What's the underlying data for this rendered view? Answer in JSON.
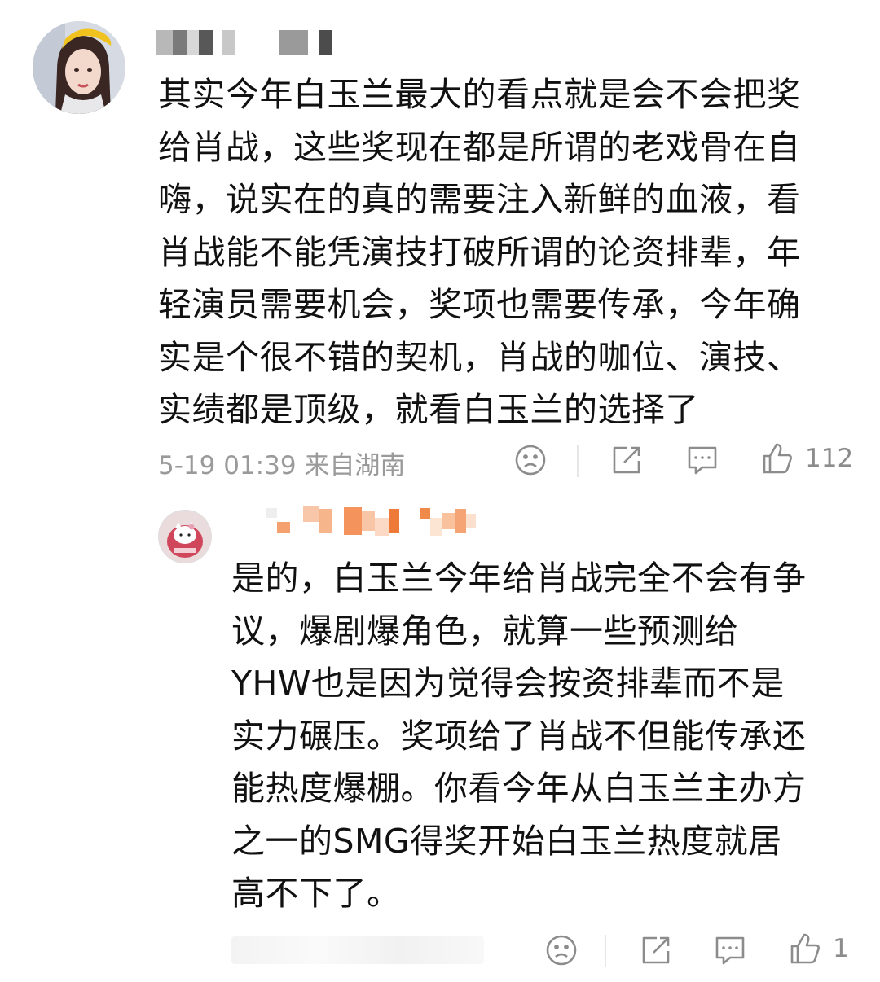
{
  "comments": [
    {
      "avatar_icon": "user-avatar-girl-yellow-hat",
      "text": "其实今年白玉兰最大的看点就是会不会把奖\n给肖战，这些奖现在都是所谓的老戏骨在自\n嗨，说实在的真的需要注入新鲜的血液，看\n肖战能不能凭演技打破所谓的论资排辈，年\n轻演员需要机会，奖项也需要传承，今年确\n实是个很不错的契机，肖战的咖位、演技、\n实绩都是顶级，就看白玉兰的选择了",
      "meta": "5-19 01:39  来自湖南",
      "actions": {
        "dislike_icon": "frown-face-icon",
        "share_icon": "share-icon",
        "comment_icon": "comment-bubble-icon",
        "like_icon": "thumbs-up-icon",
        "like_count": "112"
      }
    },
    {
      "avatar_icon": "user-avatar-hello-kitty",
      "text": "是的，白玉兰今年给肖战完全不会有争\n议，爆剧爆角色，就算一些预测给\nYHW也是因为觉得会按资排辈而不是\n实力碾压。奖项给了肖战不但能传承还\n能热度爆棚。你看今年从白玉兰主办方\n之一的SMG得奖开始白玉兰热度就居\n高不下了。",
      "actions": {
        "dislike_icon": "frown-face-icon",
        "share_icon": "share-icon",
        "comment_icon": "comment-bubble-icon",
        "like_icon": "thumbs-up-icon",
        "like_count": "1"
      }
    }
  ],
  "colors": {
    "text": "#111111",
    "meta": "#9a9a9a",
    "icon": "#8c8c8c",
    "reply_name_accent": "#f08a4b"
  }
}
